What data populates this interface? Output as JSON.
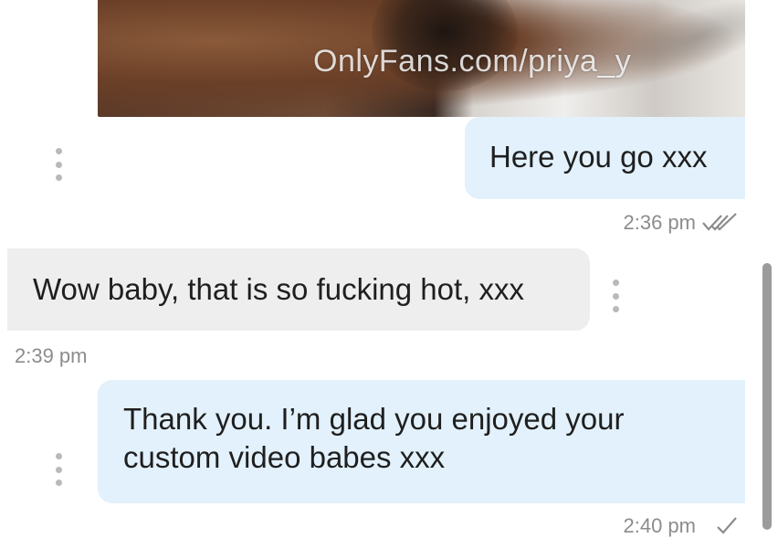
{
  "media": {
    "watermark": "OnlyFans.com/priya_y"
  },
  "messages": [
    {
      "direction": "sent",
      "text": "Here you go xxx",
      "time": "2:36 pm",
      "status": "read"
    },
    {
      "direction": "received",
      "text": "Wow baby, that is so fucking hot, xxx",
      "time": "2:39 pm"
    },
    {
      "direction": "sent",
      "text_lines": [
        "Thank you. I’m glad you enjoyed your",
        "custom video babes xxx"
      ],
      "time": "2:40 pm",
      "status": "delivered"
    }
  ],
  "icons": {
    "menu": "vertical-ellipsis-icon",
    "read_receipt": "double-check-icon",
    "delivered_receipt": "single-check-icon"
  },
  "colors": {
    "sent_bubble": "#e2f1fb",
    "received_bubble": "#eeeeef",
    "timestamp": "#8c8c8c"
  }
}
